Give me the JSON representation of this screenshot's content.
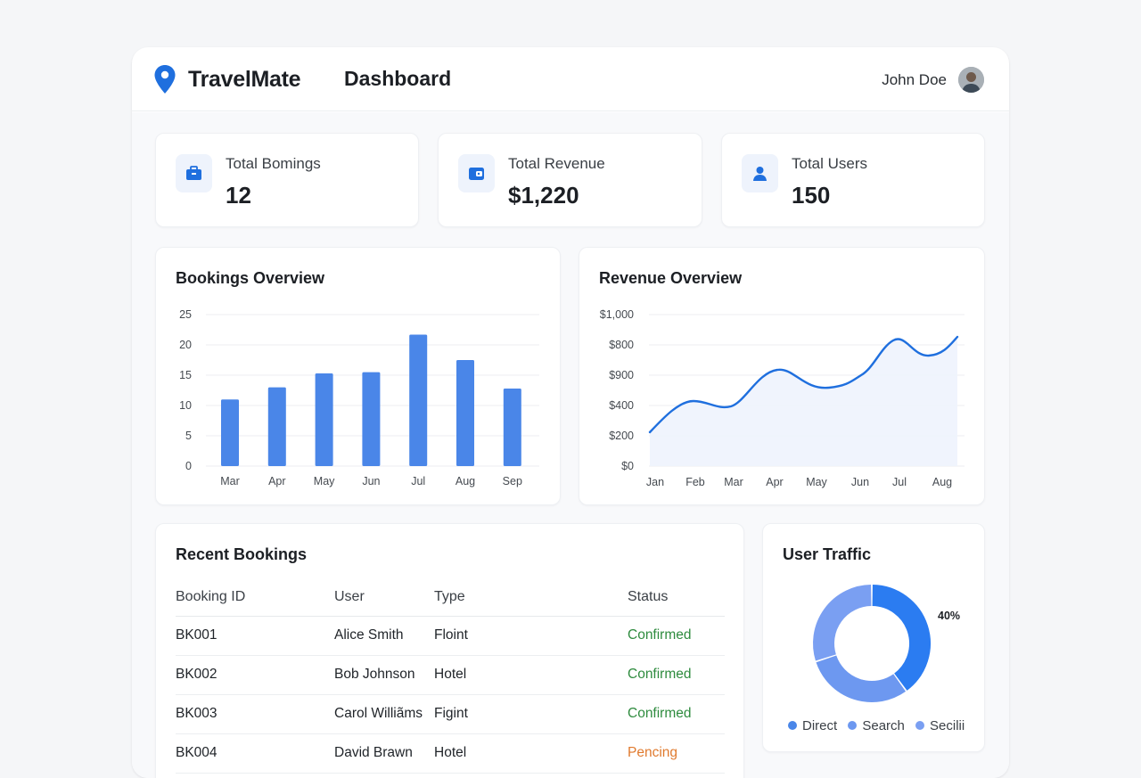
{
  "app": {
    "name": "TravelMate",
    "page_title": "Dashboard"
  },
  "user": {
    "name": "John Doe"
  },
  "stats": [
    {
      "label": "Total Bomings",
      "value": "12",
      "icon": "briefcase-icon"
    },
    {
      "label": "Total Revenue",
      "value": "$1,220",
      "icon": "wallet-icon"
    },
    {
      "label": "Total Users",
      "value": "150",
      "icon": "user-icon"
    }
  ],
  "bookings_chart": {
    "title": "Bookings Overview",
    "chart_data": {
      "type": "bar",
      "categories": [
        "Mar",
        "Apr",
        "May",
        "Jun",
        "Jul",
        "Aug",
        "Sep"
      ],
      "values": [
        11,
        13,
        15.3,
        15.5,
        21.7,
        17.5,
        12.8
      ],
      "ylim": [
        0,
        25
      ],
      "yticks": [
        "0",
        "5",
        "10",
        "15",
        "20",
        "25"
      ],
      "color": "#4a86e8"
    }
  },
  "revenue_chart": {
    "title": "Revenue Overview",
    "chart_data": {
      "type": "area",
      "categories": [
        "Jan",
        "Feb",
        "Mar",
        "Apr",
        "May",
        "Jun",
        "Jul",
        "Aug"
      ],
      "ytick_labels": [
        "$0",
        "$200",
        "$400",
        "$900",
        "$800",
        "$1,000"
      ],
      "color": "#1f6fde"
    }
  },
  "recent_bookings": {
    "title": "Recent Bookings",
    "columns": [
      "Booking ID",
      "User",
      "Type",
      "Status"
    ],
    "rows": [
      {
        "id": "BK001",
        "user": "Alice Smith",
        "type": "Floint",
        "status": "Confirmed",
        "status_kind": "ok"
      },
      {
        "id": "BK002",
        "user": "Bob Johnson",
        "type": "Hotel",
        "status": "Confirmed",
        "status_kind": "ok"
      },
      {
        "id": "BK003",
        "user": "Carol Williãms",
        "type": "Figint",
        "status": "Confirmed",
        "status_kind": "ok"
      },
      {
        "id": "BK004",
        "user": "David Brawn",
        "type": "Hotel",
        "status": "Pencing",
        "status_kind": "pending"
      }
    ]
  },
  "traffic": {
    "title": "User Traffic",
    "chart_data": {
      "type": "pie",
      "labels": [
        "Direct",
        "Search",
        "Secilii"
      ],
      "values": [
        40,
        30,
        30
      ],
      "data_label": "40%",
      "colors": [
        "#2b7cf1",
        "#6d98f0",
        "#7a9ff2"
      ]
    }
  },
  "colors": {
    "accent": "#1f6fde",
    "ok": "#2e8b3e",
    "pending": "#e07a2e"
  }
}
